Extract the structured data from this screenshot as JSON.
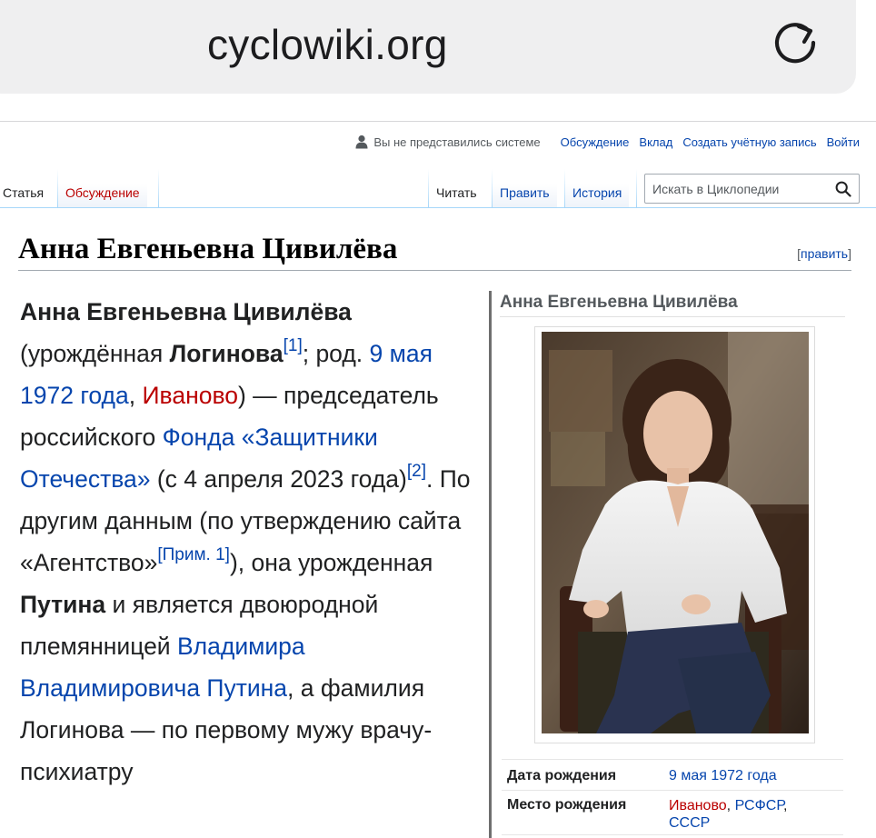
{
  "browser": {
    "url": "cyclowiki.org"
  },
  "personal_tools": {
    "anon_text": "Вы не представились системе",
    "links": [
      "Обсуждение",
      "Вклад",
      "Создать учётную запись",
      "Войти"
    ]
  },
  "tabs": {
    "left": [
      {
        "label": "Статья",
        "selected": true
      },
      {
        "label": "Обсуждение",
        "selected": false
      }
    ],
    "right": [
      {
        "label": "Читать",
        "selected": true
      },
      {
        "label": "Править",
        "selected": false
      },
      {
        "label": "История",
        "selected": false
      }
    ]
  },
  "search": {
    "placeholder": "Искать в Циклопедии"
  },
  "article": {
    "title": "Анна Евгеньевна Цивилёва",
    "edit_label": "править",
    "lead": {
      "subject": "Анна Евгеньевна Цивилёва",
      "t1": "(урождённая ",
      "birth_name": "Логинова",
      "ref1": "[1]",
      "t2": "; род. ",
      "birth_date": "9 мая 1972 года",
      "t3": ", ",
      "birth_place": "Иваново",
      "t4": ") — председатель российского ",
      "fund": "Фонда «Защитники Отечества»",
      "t5": " (с 4 апреля 2023 года)",
      "ref2": "[2]",
      "t6": ". По другим данным (по утверждению сайта «Агентство»",
      "note1": "[Прим. 1]",
      "t7": "), она урожденная ",
      "other_name": "Путина",
      "t8": " и является двоюродной племянницей ",
      "relative": "Владимира Владимировича Путина",
      "t9": ", а фамилия Логинова — по первому мужу врачу-психиатру"
    }
  },
  "infobox": {
    "title": "Анна Евгеньевна Цивилёва",
    "rows": [
      {
        "label": "Дата рождения",
        "value": "9 мая 1972 года"
      },
      {
        "label": "Место рождения",
        "place": "Иваново",
        "region": "РСФСР",
        "country": "СССР"
      }
    ]
  },
  "colors": {
    "link": "#0645ad",
    "new_link": "#ba0000",
    "text": "#202122",
    "tab_border": "#a7d7f9"
  }
}
